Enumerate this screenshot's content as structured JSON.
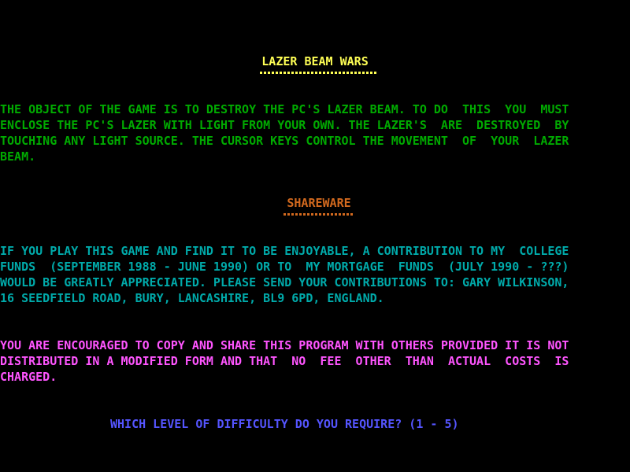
{
  "title": {
    "text": "LAZER BEAM WARS",
    "color": "#FFFF55"
  },
  "objective": {
    "color": "#00AA00",
    "lines": [
      "THE OBJECT OF THE GAME IS TO DESTROY THE PC'S LAZER BEAM. TO DO  THIS  YOU  MUST",
      "ENCLOSE THE PC'S LAZER WITH LIGHT FROM YOUR OWN. THE LAZER'S  ARE  DESTROYED  BY",
      "TOUCHING ANY LIGHT SOURCE. THE CURSOR KEYS CONTROL THE MOVEMENT  OF  YOUR  LAZER",
      "BEAM."
    ]
  },
  "shareware_heading": {
    "text": "SHAREWARE",
    "color": "#D2691E"
  },
  "contribution": {
    "color": "#00AAAA",
    "lines": [
      "IF YOU PLAY THIS GAME AND FIND IT TO BE ENJOYABLE, A CONTRIBUTION TO MY  COLLEGE",
      "FUNDS  (SEPTEMBER 1988 - JUNE 1990) OR TO  MY MORTGAGE  FUNDS  (JULY 1990 - ???)",
      "WOULD BE GREATLY APPRECIATED. PLEASE SEND YOUR CONTRIBUTIONS TO: GARY WILKINSON,",
      "16 SEEDFIELD ROAD, BURY, LANCASHIRE, BL9 6PD, ENGLAND."
    ]
  },
  "copy_notice": {
    "color": "#FF55FF",
    "lines": [
      "YOU ARE ENCOURAGED TO COPY AND SHARE THIS PROGRAM WITH OTHERS PROVIDED IT IS NOT",
      "DISTRIBUTED IN A MODIFIED FORM AND THAT  NO  FEE  OTHER  THAN  ACTUAL  COSTS  IS",
      "CHARGED."
    ]
  },
  "prompt": {
    "text": "WHICH LEVEL OF DIFFICULTY DO YOU REQUIRE? (1 - 5)",
    "color": "#5555FF"
  }
}
